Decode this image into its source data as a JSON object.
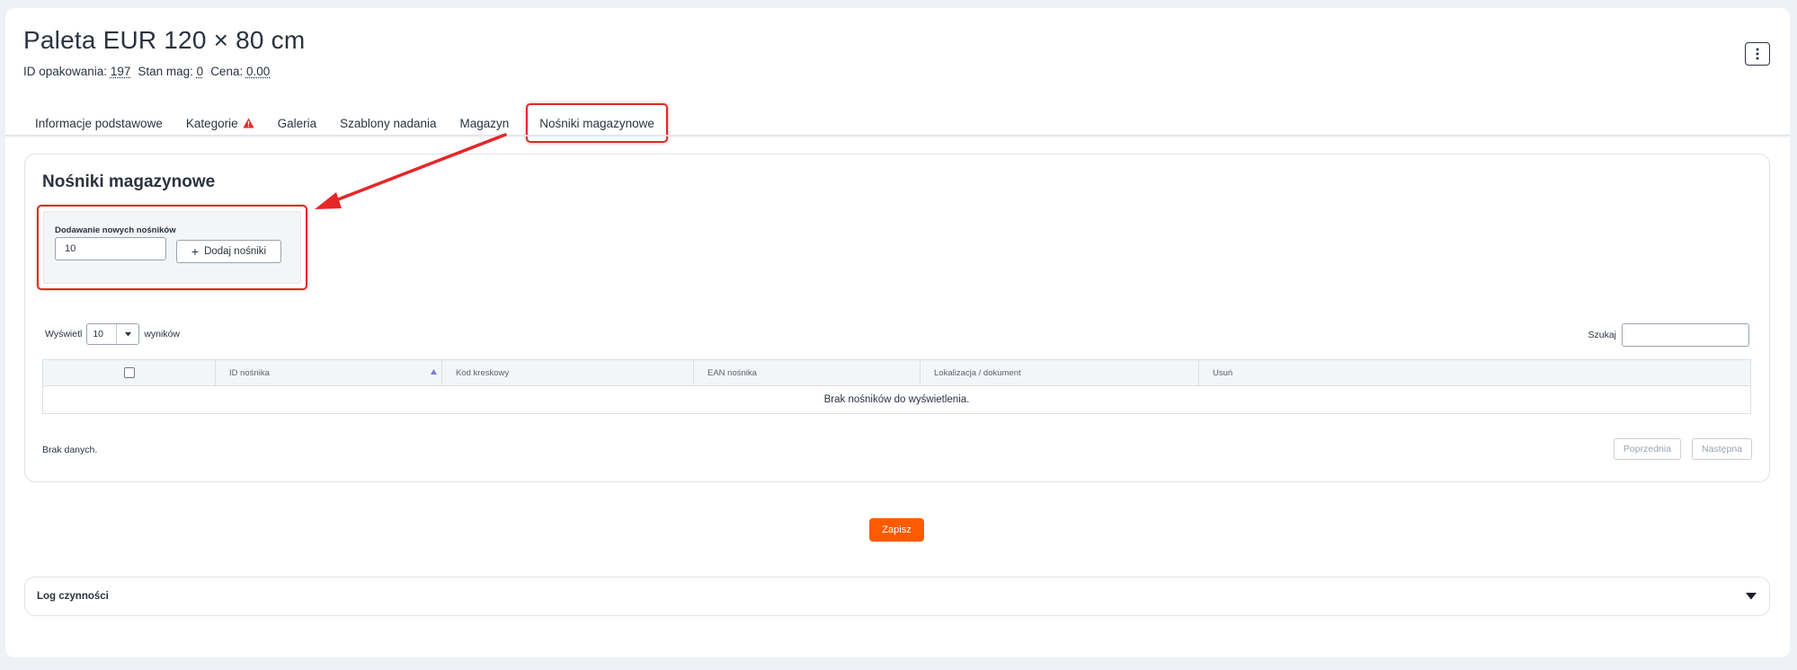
{
  "header": {
    "title": "Paleta EUR 120 × 80 cm",
    "meta": [
      {
        "label": "ID opakowania:",
        "value": "197"
      },
      {
        "label": "Stan mag:",
        "value": "0"
      },
      {
        "label": "Cena:",
        "value": "0.00"
      }
    ],
    "menu_icon": "kebab-menu-icon"
  },
  "tabs": [
    {
      "label": "Informacje podstawowe",
      "warning": false
    },
    {
      "label": "Kategorie",
      "warning": true
    },
    {
      "label": "Galeria",
      "warning": false
    },
    {
      "label": "Szablony nadania",
      "warning": false
    },
    {
      "label": "Magazyn",
      "warning": false
    },
    {
      "label": "Nośniki magazynowe",
      "warning": false,
      "active": true
    }
  ],
  "section": {
    "title": "Nośniki magazynowe",
    "add_box": {
      "label": "Dodawanie nowych nośników",
      "input_value": "10",
      "button_label": "Dodaj nośniki"
    },
    "show": {
      "prefix": "Wyświetl",
      "value": "10",
      "suffix": "wyników"
    },
    "search_label": "Szukaj",
    "table": {
      "columns": [
        "",
        "ID nośnika",
        "Kod kreskowy",
        "EAN nośnika",
        "Lokalizacja / dokument",
        "Usuń"
      ],
      "empty_text": "Brak nośników do wyświetlenia."
    },
    "no_data": "Brak danych.",
    "pager": {
      "prev": "Poprzednia",
      "next": "Następna"
    }
  },
  "save_label": "Zapisz",
  "log_title": "Log czynności",
  "colors": {
    "accent": "#fe5b00",
    "highlight": "#e52727",
    "text": "#2b3340"
  }
}
